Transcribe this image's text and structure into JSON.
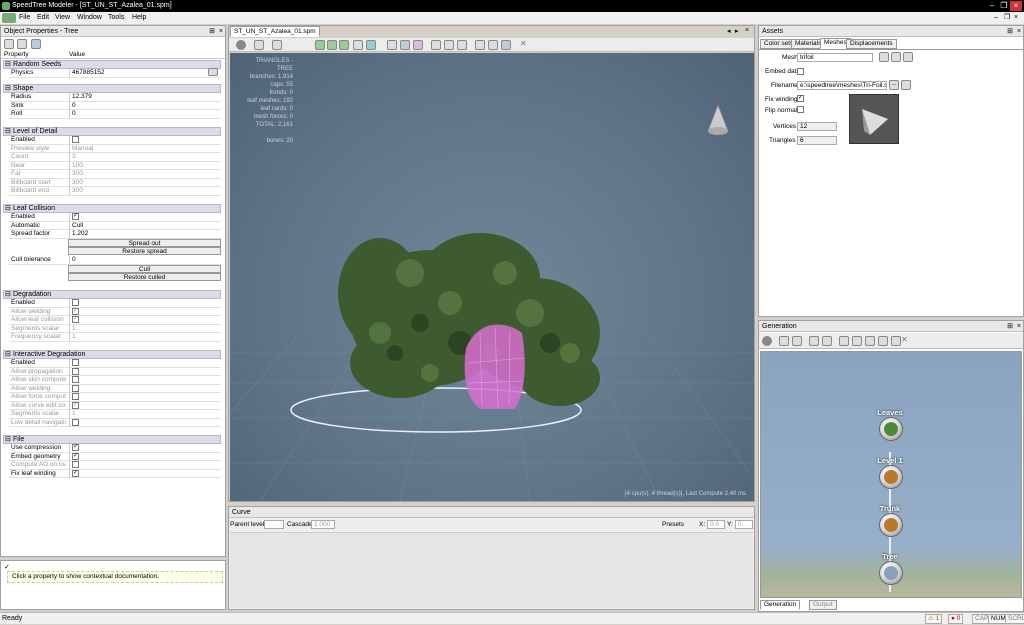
{
  "app": {
    "title": "SpeedTree Modeler - [ST_UN_ST_Azalea_01.spm]"
  },
  "menu": [
    "File",
    "Edit",
    "View",
    "Window",
    "Tools",
    "Help"
  ],
  "object_properties": {
    "title": "Object Properties - Tree",
    "col_property": "Property",
    "col_value": "Value",
    "groups": {
      "random_seeds": {
        "label": "Random Seeds",
        "physics_label": "Physics",
        "physics_value": "467885152"
      },
      "shape": {
        "label": "Shape",
        "radius_label": "Radius",
        "radius_value": "12.379",
        "sink_label": "Sink",
        "sink_value": "0",
        "roll_label": "Roll",
        "roll_value": "0"
      },
      "lod": {
        "label": "Level of Detail",
        "enabled": "Enabled",
        "preview_style": "Preview style",
        "preview_value": "Manual",
        "count": "Count",
        "count_value": "3",
        "near": "Near",
        "near_value": "100",
        "far": "Far",
        "far_value": "300",
        "bb_start": "Billboard start",
        "bb_start_value": "300",
        "bb_end": "Billboard end",
        "bb_end_value": "300"
      },
      "leaf_collision": {
        "label": "Leaf Collision",
        "enabled": "Enabled",
        "automatic": "Automatic",
        "automatic_value": "Cull",
        "spread_factor": "Spread factor",
        "spread_value": "1.202",
        "spread_out": "Spread out",
        "restore_spread": "Restore spread",
        "cull_tolerance": "Cull tolerance",
        "cull_tol_value": "0",
        "cull": "Cull",
        "restore_culled": "Restore culled"
      },
      "degradation": {
        "label": "Degradation",
        "enabled": "Enabled",
        "allow_welding": "Allow welding",
        "allow_leaf": "Allow leaf collision",
        "segments": "Segments scalar",
        "segments_value": "1",
        "frequency": "Frequency scalar",
        "frequency_value": "1"
      },
      "interactive": {
        "label": "Interactive Degradation",
        "enabled": "Enabled",
        "allow_propagation": "Allow propagation",
        "allow_skin": "Allow skin compute",
        "allow_welding": "Allow welding",
        "allow_force": "Allow force compute",
        "allow_curve": "Allow curve edit co",
        "segments": "Segments scalar",
        "segments_value": "1",
        "low_detail": "Low detail navigation"
      },
      "file": {
        "label": "File",
        "use_compression": "Use compression",
        "embed_geometry": "Embed geometry",
        "compute_ao": "Compute AO on load",
        "fix_leaf": "Fix leaf winding"
      }
    },
    "help_text": "Click a property to show contextual documentation."
  },
  "viewport": {
    "tab": "ST_UN_ST_Azalea_01.spm",
    "stats": [
      "TRIANGLES - TREE",
      "branches: 1,914",
      "caps: 55",
      "fronds: 0",
      "leaf meshes: 192",
      "leaf cards: 0",
      "mesh forces: 0",
      "TOTAL: 2,161",
      "",
      "bones: 20"
    ],
    "compute_info": "[4 cpu(s), 4 thread(s)], Last Compute 2.40 ms"
  },
  "curve": {
    "title": "Curve",
    "parent_level": "Parent level:",
    "cascade": "Cascade:",
    "cascade_value": "1.000",
    "presets": "Presets",
    "x_label": "X:",
    "x_value": "0.0",
    "y_label": "Y:",
    "y_value": "0."
  },
  "assets": {
    "title": "Assets",
    "tabs": [
      "Color sets",
      "Materials",
      "Meshes",
      "Displacements"
    ],
    "mesh_label": "Mesh",
    "mesh_value": "trifoil",
    "embed_label": "Embed data",
    "filename_label": "Filename",
    "filename_value": "e:\\speedtree\\meshes\\Tri-Foil.stm",
    "fix_winding": "Fix winding",
    "flip_normals": "Flip normals",
    "vertices_label": "Vertices",
    "vertices_value": "12",
    "triangles_label": "Triangles",
    "triangles_value": "6"
  },
  "generation": {
    "title": "Generation",
    "nodes": [
      "Leaves",
      "Level 1",
      "Trunk",
      "Tree"
    ],
    "bottom_tabs": [
      "Generation",
      "Output"
    ]
  },
  "status": {
    "ready": "Ready",
    "warnings": "1",
    "errors": "0",
    "cap": "CAP",
    "num": "NUM",
    "scrl": "SCRL"
  },
  "colors": {
    "viewport_bg": "#5f7487",
    "graph_bg": "#8fa7c2",
    "foliage": "#3d5b2e",
    "pink_mesh": "#d86fd0"
  }
}
